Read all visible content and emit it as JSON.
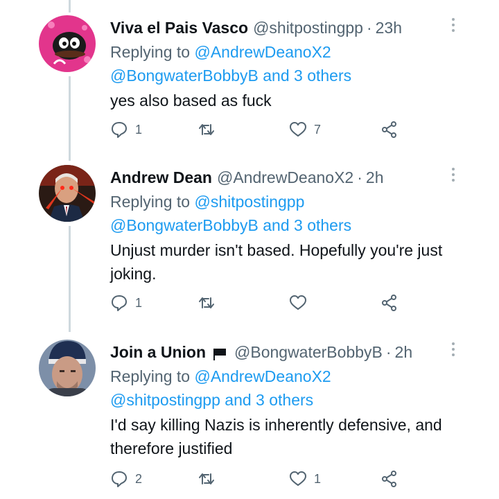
{
  "tweets": [
    {
      "name": "Viva el Pais Vasco",
      "handle": "@shitpostingpp",
      "time": "23h",
      "replying_prefix": "Replying to",
      "replying_to": "@AndrewDeanoX2",
      "replying_line2_user": "@BongwaterBobbyB",
      "replying_and": "and",
      "replying_others": "3 others",
      "text": "yes also based as fuck",
      "reply_count": "1",
      "retweet_count": "",
      "like_count": "7"
    },
    {
      "name": "Andrew Dean",
      "handle": "@AndrewDeanoX2",
      "time": "2h",
      "replying_prefix": "Replying to",
      "replying_to": "@shitpostingpp",
      "replying_line2_user": "@BongwaterBobbyB",
      "replying_and": "and",
      "replying_others": "3 others",
      "text": "Unjust murder isn't based. Hopefully you're just joking.",
      "reply_count": "1",
      "retweet_count": "",
      "like_count": ""
    },
    {
      "name": "Join a Union",
      "name_flag_icon": "black-flag-icon",
      "handle": "@BongwaterBobbyB",
      "time": "2h",
      "replying_prefix": "Replying to",
      "replying_to": "@AndrewDeanoX2",
      "replying_line2_user": "@shitpostingpp",
      "replying_and": "and",
      "replying_others": "3 others",
      "text": "I'd say killing Nazis is inherently defensive, and therefore justified",
      "reply_count": "2",
      "retweet_count": "",
      "like_count": "1"
    }
  ],
  "icons": {
    "reply": "reply-icon",
    "retweet": "retweet-icon",
    "like": "heart-icon",
    "share": "share-icon",
    "more": "more-vertical-icon"
  },
  "colors": {
    "link": "#1d9bf0",
    "secondary_text": "#536471",
    "thread_line": "#cfd9de"
  }
}
